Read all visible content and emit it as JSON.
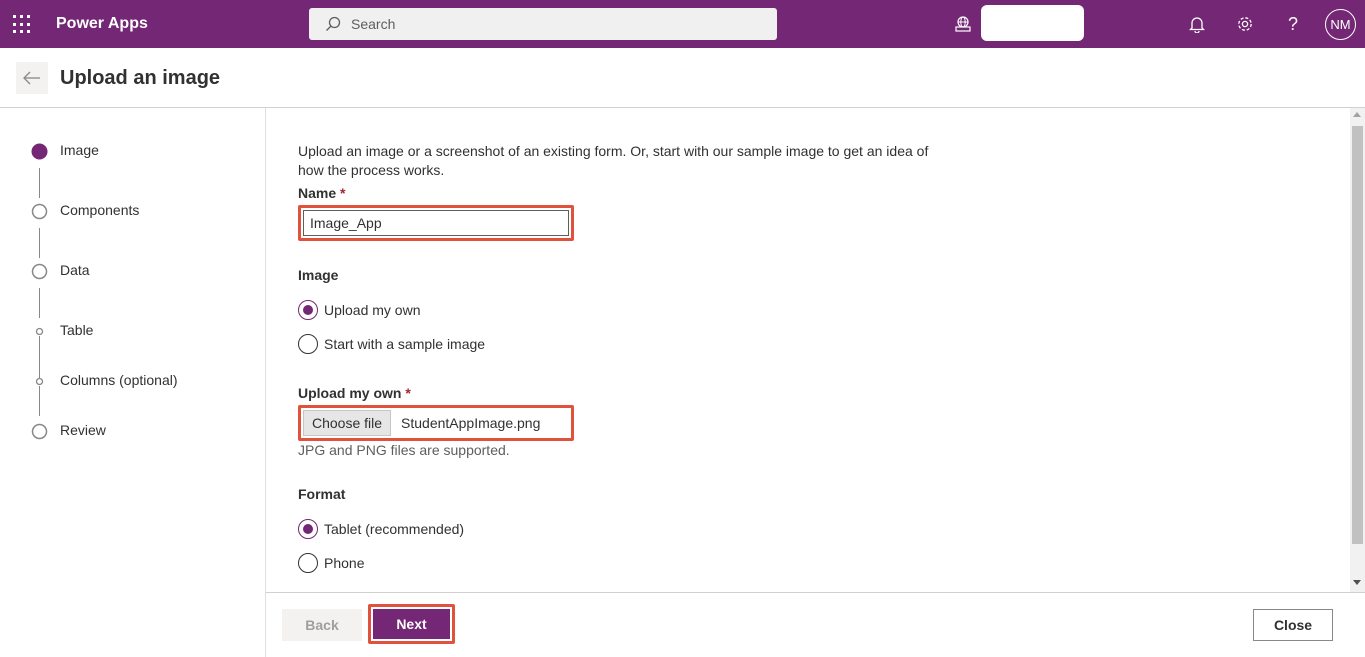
{
  "topbar": {
    "app_name": "Power Apps",
    "search_placeholder": "Search",
    "avatar_initials": "NM",
    "icons": [
      "waffle-icon",
      "search-icon",
      "environment-icon",
      "bell-icon",
      "gear-icon",
      "help-icon"
    ]
  },
  "header": {
    "title": "Upload an image"
  },
  "stepper": {
    "steps": [
      {
        "label": "Image",
        "state": "current"
      },
      {
        "label": "Components",
        "state": "pending"
      },
      {
        "label": "Data",
        "state": "pending"
      },
      {
        "label": "Table",
        "state": "substep"
      },
      {
        "label": "Columns (optional)",
        "state": "substep"
      },
      {
        "label": "Review",
        "state": "pending"
      }
    ]
  },
  "form": {
    "intro": "Upload an image or a screenshot of an existing form. Or, start with our sample image to get an idea of how the process works.",
    "name_label": "Name",
    "required_mark": "*",
    "name_value": "Image_App",
    "image_label": "Image",
    "image_options": [
      {
        "label": "Upload my own",
        "checked": true
      },
      {
        "label": "Start with a sample image",
        "checked": false
      }
    ],
    "upload_label": "Upload my own",
    "choose_file_label": "Choose file",
    "file_name": "StudentAppImage.png",
    "upload_help": "JPG and PNG files are supported.",
    "format_label": "Format",
    "format_options": [
      {
        "label": "Tablet (recommended)",
        "checked": true
      },
      {
        "label": "Phone",
        "checked": false
      }
    ]
  },
  "footer": {
    "back_label": "Back",
    "next_label": "Next",
    "close_label": "Close"
  },
  "colors": {
    "brand": "#742774",
    "highlight": "#e1523d"
  }
}
